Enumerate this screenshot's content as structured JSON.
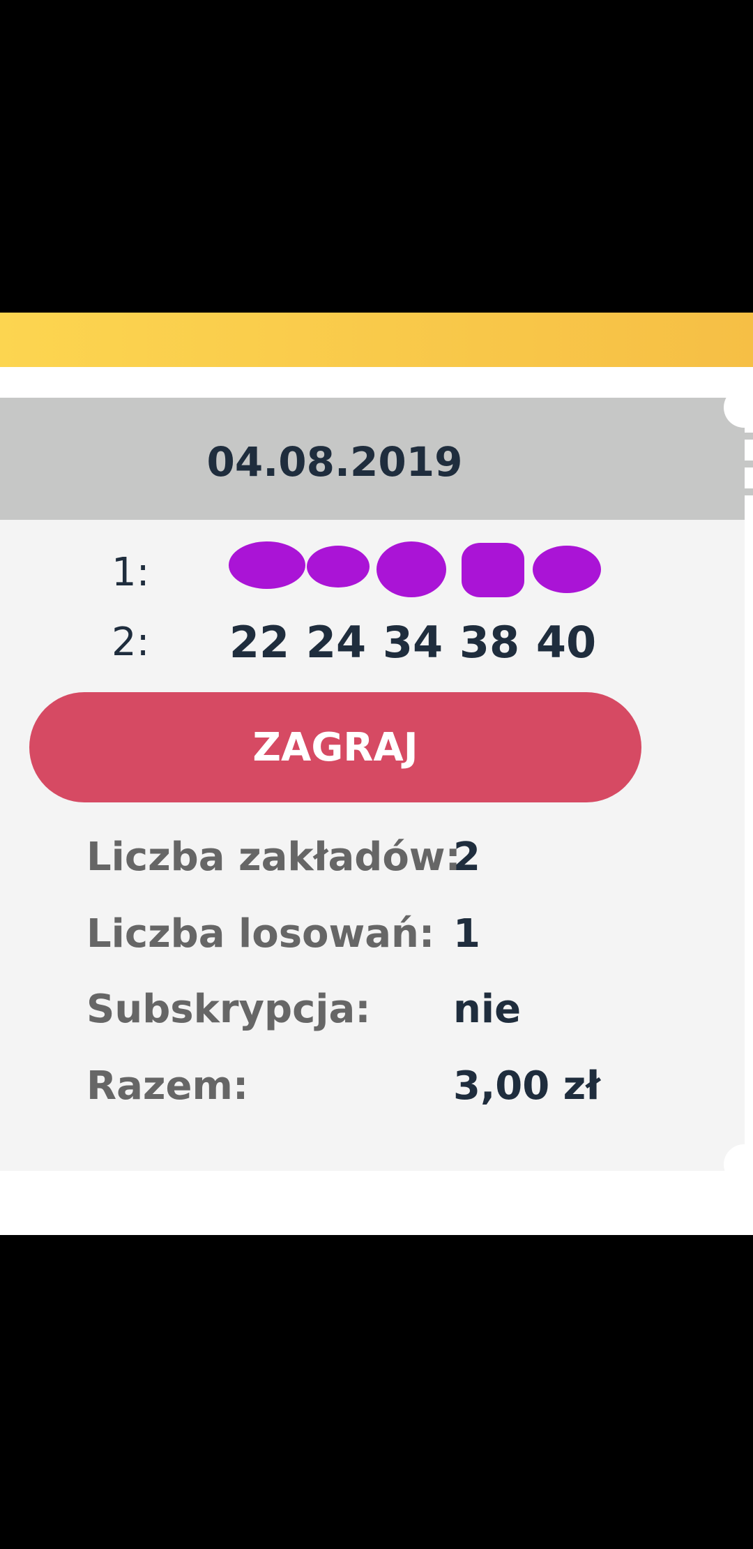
{
  "ticket": {
    "date": "04.08.2019",
    "bets": [
      {
        "label": "1:",
        "numbers": [
          "",
          "",
          "",
          "",
          ""
        ],
        "redacted": true
      },
      {
        "label": "2:",
        "numbers": [
          "22",
          "24",
          "34",
          "38",
          "40"
        ],
        "redacted": false
      }
    ],
    "play_button_label": "ZAGRAJ",
    "summary": [
      {
        "label": "Liczba zakładów:",
        "value": "2"
      },
      {
        "label": "Liczba losowań:",
        "value": "1"
      },
      {
        "label": "Subskrypcja:",
        "value": "nie"
      },
      {
        "label": "Razem:",
        "value": "3,00 zł"
      }
    ]
  },
  "colors": {
    "accent_yellow": "#f8c845",
    "button_red": "#d64a63",
    "header_gray": "#c6c7c6",
    "text_dark": "#1f2d3d",
    "text_gray": "#666666",
    "redaction_purple": "#a300d2"
  }
}
